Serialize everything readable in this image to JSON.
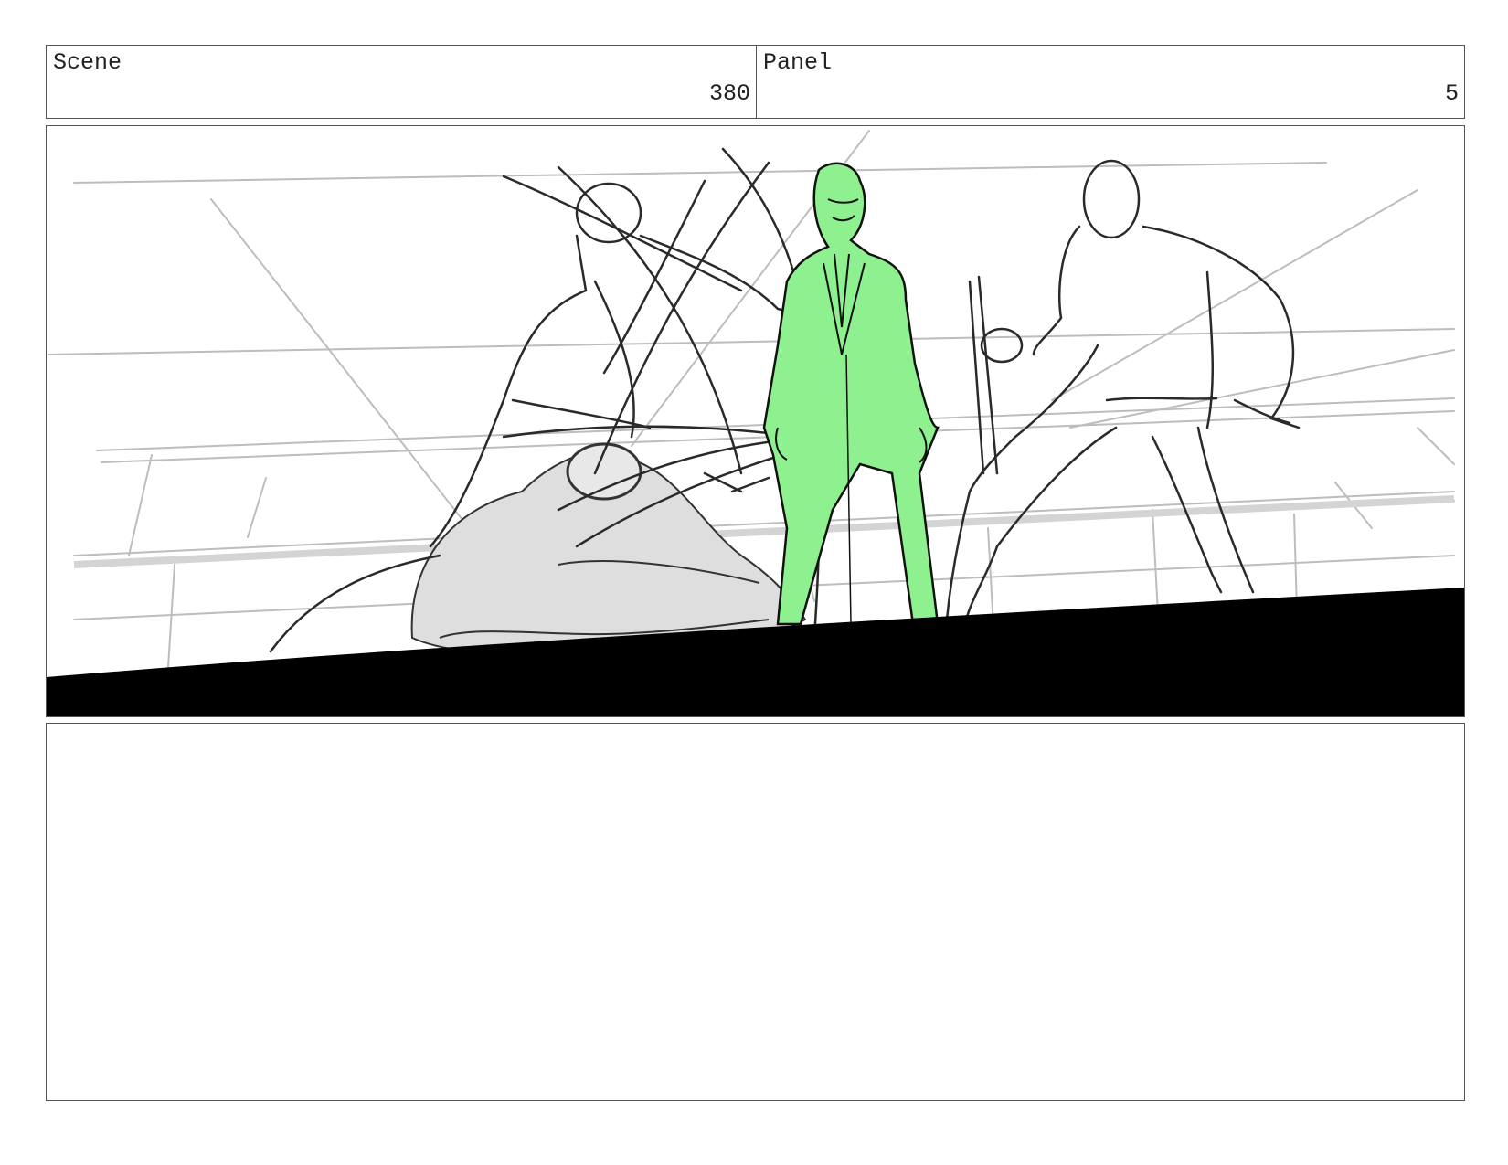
{
  "header": {
    "scene_label": "Scene",
    "scene_number": "380",
    "panel_label": "Panel",
    "panel_number": "5"
  },
  "colors": {
    "highlight_figure": "#8ef08e",
    "shadow_figure": "#dedede",
    "ground": "#000000",
    "sketch_line": "#222222",
    "background_line": "#bdbdbd"
  },
  "notes": {
    "text": ""
  }
}
